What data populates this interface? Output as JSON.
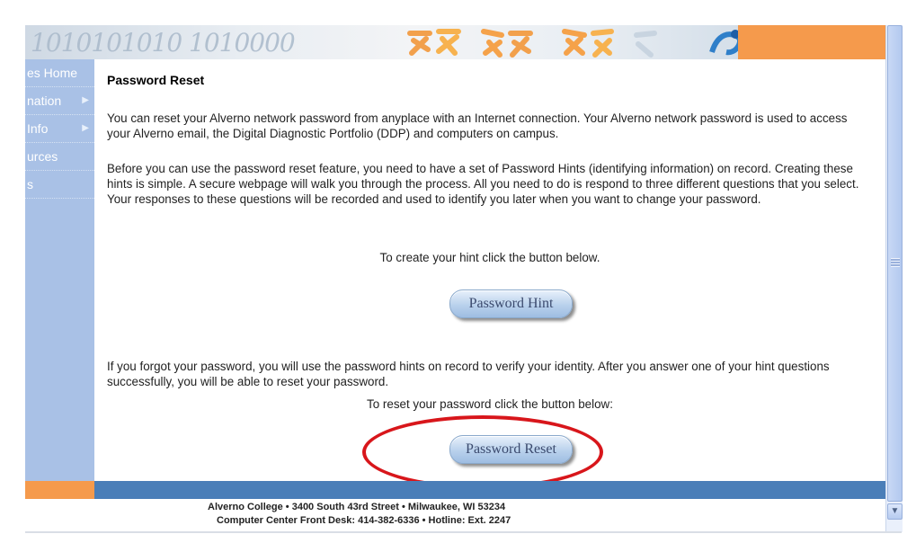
{
  "nav": {
    "items": [
      {
        "label": "es Home",
        "arrow": ""
      },
      {
        "label": "nation",
        "arrow": "▶"
      },
      {
        "label": " Info",
        "arrow": "▶"
      },
      {
        "label": "urces",
        "arrow": ""
      },
      {
        "label": "s",
        "arrow": ""
      }
    ]
  },
  "page": {
    "title": "Password Reset",
    "intro": "You can reset your Alverno network password from anyplace with an Internet connection. Your Alverno network password is used to access your Alverno email, the Digital Diagnostic Portfolio (DDP) and computers on campus.",
    "hints_info": "Before you can use the password reset feature, you need to have a set of Password Hints (identifying information) on record. Creating these hints is simple. A secure webpage will walk you through the process. All you need to do is respond to three different questions that you select. Your responses to these questions will be recorded and used to identify you later when you want to change your password.",
    "hint_prompt": "To create your hint click the button below.",
    "hint_button": "Password Hint",
    "forgot_info": "If you forgot your password, you will use the password hints on record to verify your identity. After you answer one of your hint questions successfully, you will be able to reset your password.",
    "reset_prompt": "To reset your password click the button below:",
    "reset_button": "Password Reset"
  },
  "footer": {
    "line1": "Alverno College  •  3400 South 43rd Street  •  Milwaukee, WI 53234",
    "line2": "Computer Center Front Desk: 414-382-6336  •  Hotline: Ext. 2247"
  },
  "colors": {
    "nav_bg": "#a9c1e6",
    "accent_orange": "#f59a4c",
    "footer_blue": "#4a7eb8",
    "highlight_red": "#d8161b"
  },
  "icons": {
    "scroll_down": "▼"
  }
}
